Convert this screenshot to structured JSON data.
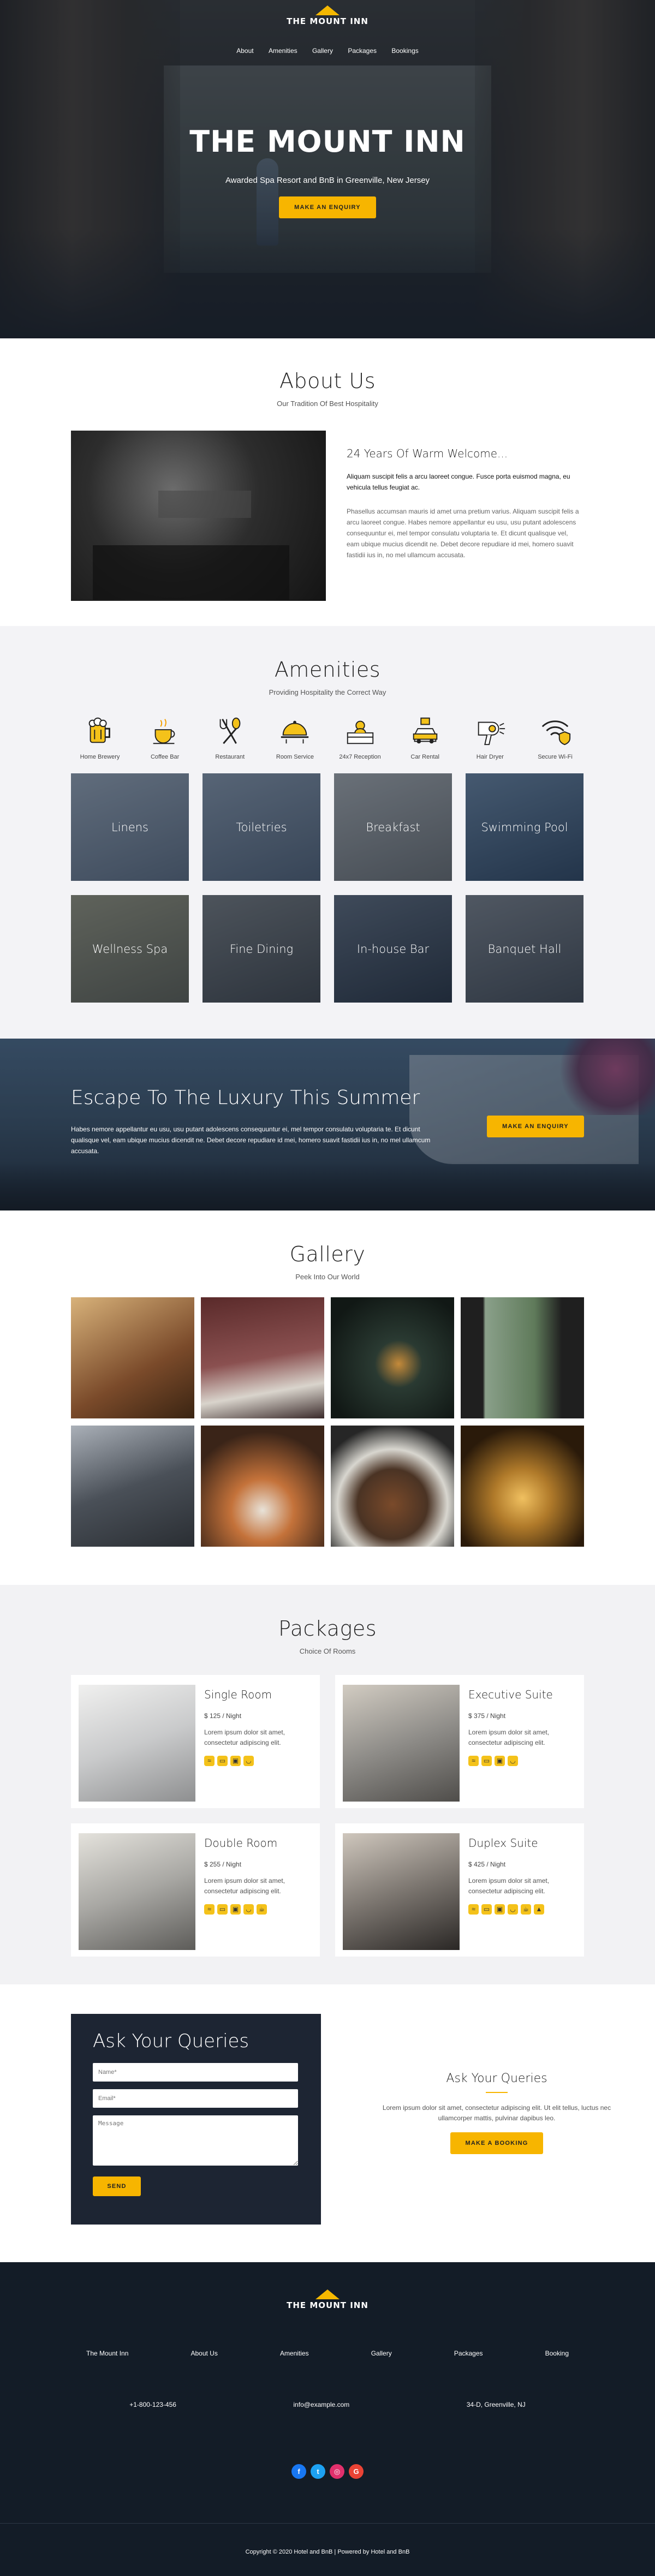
{
  "brand": {
    "name": "THE MOUNT INN"
  },
  "nav": [
    "About",
    "Amenities",
    "Gallery",
    "Packages",
    "Bookings"
  ],
  "hero": {
    "headline": "THE MOUNT INN",
    "tagline": "Awarded Spa Resort and BnB in Greenville, New Jersey",
    "button": "MAKE AN ENQUIRY"
  },
  "about": {
    "title": "About Us",
    "subtitle": "Our Tradition Of Best Hospitality",
    "heading": "24 Years Of Warm Welcome...",
    "lead": "Aliquam suscipit felis a arcu laoreet congue. Fusce porta euismod magna, eu vehicula tellus feugiat ac.",
    "body": "Phasellus accumsan mauris id amet urna pretium varius. Aliquam suscipit felis a arcu laoreet congue. Habes nemore appellantur eu usu, usu putant adolescens consequuntur ei, mel tempor consulatu voluptaria te. Et dicunt qualisque vel, eam ubique mucius dicendit ne. Debet decore repudiare id mei, homero suavit fastidii ius in, no mel ullamcum accusata."
  },
  "amenities": {
    "title": "Amenities",
    "subtitle": "Providing Hospitality the Correct Way",
    "icons": [
      {
        "label": "Home Brewery",
        "icon": "beer-icon"
      },
      {
        "label": "Coffee Bar",
        "icon": "coffee-cup-icon"
      },
      {
        "label": "Restaurant",
        "icon": "utensils-icon"
      },
      {
        "label": "Room Service",
        "icon": "room-service-icon"
      },
      {
        "label": "24x7 Reception",
        "icon": "reception-bell-icon"
      },
      {
        "label": "Car Rental",
        "icon": "car-icon"
      },
      {
        "label": "Hair Dryer",
        "icon": "hair-dryer-icon"
      },
      {
        "label": "Secure Wi-Fi",
        "icon": "wifi-shield-icon"
      }
    ],
    "tiles": [
      {
        "label": "Linens",
        "color": "#8b939c"
      },
      {
        "label": "Toiletries",
        "color": "#7d8794"
      },
      {
        "label": "Breakfast",
        "color": "#a4a09a"
      },
      {
        "label": "Swimming Pool",
        "color": "#5a6f86"
      },
      {
        "label": "Wellness Spa",
        "color": "#9a8f6c"
      },
      {
        "label": "Fine Dining",
        "color": "#6e6a63"
      },
      {
        "label": "In-house Bar",
        "color": "#4a4f57"
      },
      {
        "label": "Banquet Hall",
        "color": "#6e6d6c"
      }
    ]
  },
  "promo": {
    "title": "Escape To The Luxury This Summer",
    "body": "Habes nemore appellantur eu usu, usu putant adolescens consequuntur ei, mel tempor consulatu voluptaria te. Et dicunt qualisque vel, eam ubique mucius dicendit ne. Debet decore repudiare id mei, homero suavit fastidii ius in, no mel ullamcum accusata.",
    "button": "MAKE AN ENQUIRY"
  },
  "gallery": {
    "title": "Gallery",
    "subtitle": "Peek Into Our World",
    "images": [
      {
        "name": "gallery-bedroom",
        "color": "#8a6a42"
      },
      {
        "name": "gallery-suite",
        "color": "#6b3a3a"
      },
      {
        "name": "gallery-corridor",
        "color": "#1e2a24"
      },
      {
        "name": "gallery-window-view",
        "color": "#3c4a3a"
      },
      {
        "name": "gallery-chef-kitchen",
        "color": "#4a5058"
      },
      {
        "name": "gallery-plating",
        "color": "#9a5a2c"
      },
      {
        "name": "gallery-steak",
        "color": "#4a3324"
      },
      {
        "name": "gallery-champagne",
        "color": "#3a2814"
      }
    ]
  },
  "packages": {
    "title": "Packages",
    "subtitle": "Choice Of Rooms",
    "items": [
      {
        "name": "Single Room",
        "price": "$ 125 / Night",
        "desc": "Lorem ipsum dolor sit amet, consectetur adipiscing elit.",
        "color": "#c9cacb"
      },
      {
        "name": "Executive Suite",
        "price": "$ 375 / Night",
        "desc": "Lorem ipsum dolor sit amet, consectetur adipiscing elit.",
        "color": "#8f8d89"
      },
      {
        "name": "Double Room",
        "price": "$ 255 / Night",
        "desc": "Lorem ipsum dolor sit amet, consectetur adipiscing elit.",
        "color": "#a8a7a3"
      },
      {
        "name": "Duplex Suite",
        "price": "$ 425 / Night",
        "desc": "Lorem ipsum dolor sit amet, consectetur adipiscing elit.",
        "color": "#7c7670"
      }
    ]
  },
  "queries": {
    "form_title": "Ask Your Queries",
    "name_placeholder": "Name*",
    "email_placeholder": "Email*",
    "message_placeholder": "Message",
    "send": "SEND",
    "side_title": "Ask Your Queries",
    "side_text": "Lorem ipsum dolor sit amet, consectetur adipiscing elit. Ut elit tellus, luctus nec ullamcorper mattis, pulvinar dapibus leo.",
    "side_button": "MAKE A BOOKING"
  },
  "footer": {
    "links": [
      "The Mount Inn",
      "About Us",
      "Amenities",
      "Gallery",
      "Packages",
      "Booking"
    ],
    "phone": "+1-800-123-456",
    "email": "info@example.com",
    "address": "34-D, Greenville, NJ",
    "social": [
      {
        "name": "facebook-icon",
        "glyph": "f",
        "color": "#1877f2"
      },
      {
        "name": "twitter-icon",
        "glyph": "t",
        "color": "#1da1f2"
      },
      {
        "name": "instagram-icon",
        "glyph": "◎",
        "color": "#e1306c"
      },
      {
        "name": "google-icon",
        "glyph": "G",
        "color": "#ea4335"
      }
    ],
    "copyright": "Copyright © 2020 Hotel and BnB | Powered by Hotel and BnB"
  },
  "colors": {
    "accent": "#f7b500",
    "dark": "#131c27"
  }
}
